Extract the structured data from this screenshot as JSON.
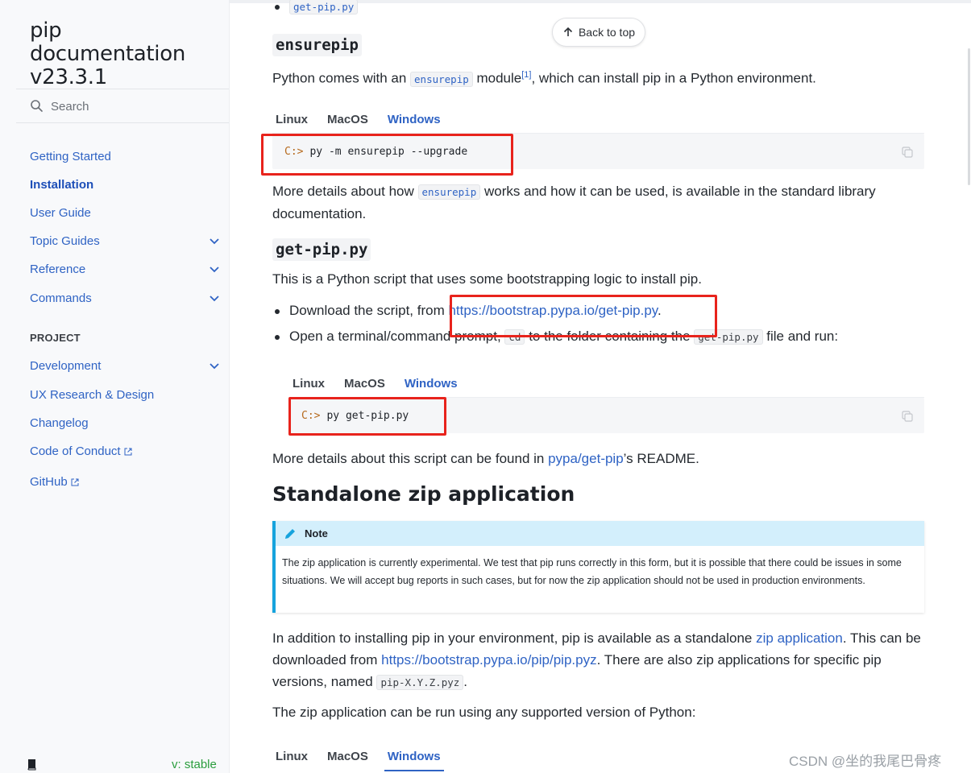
{
  "sidebar": {
    "brand": "pip documentation v23.3.1",
    "search_label": "Search",
    "items": [
      {
        "label": "Getting Started",
        "active": false,
        "expandable": false
      },
      {
        "label": "Installation",
        "active": true,
        "expandable": false
      },
      {
        "label": "User Guide",
        "active": false,
        "expandable": false
      },
      {
        "label": "Topic Guides",
        "active": false,
        "expandable": true
      },
      {
        "label": "Reference",
        "active": false,
        "expandable": true
      },
      {
        "label": "Commands",
        "active": false,
        "expandable": true
      }
    ],
    "project_caption": "PROJECT",
    "project_items": [
      {
        "label": "Development",
        "expandable": true,
        "external": false
      },
      {
        "label": "UX Research & Design",
        "expandable": false,
        "external": false
      },
      {
        "label": "Changelog",
        "expandable": false,
        "external": false
      },
      {
        "label": "Code of Conduct",
        "expandable": false,
        "external": true
      },
      {
        "label": "GitHub",
        "expandable": false,
        "external": true
      }
    ],
    "version_label": "v: stable"
  },
  "header": {
    "back_to_top": "Back to top"
  },
  "main": {
    "top_bullet_code": "get-pip.py",
    "ensurepip_section": {
      "heading": "ensurepip",
      "intro_before": "Python comes with an ",
      "intro_code": "ensurepip",
      "intro_mid": " module",
      "intro_ref": "[1]",
      "intro_after": ", which can install pip in a Python environment.",
      "tabs": [
        "Linux",
        "MacOS",
        "Windows"
      ],
      "active_tab": "Windows",
      "code_prompt": "C:>",
      "code_command": "py -m ensurepip --upgrade",
      "details_before": "More details about how ",
      "details_code": "ensurepip",
      "details_after_line1": " works and how it can be used, is available in the standard library",
      "details_line2": "documentation."
    },
    "getpip_section": {
      "heading": "get-pip.py",
      "intro": "This is a Python script that uses some bootstrapping logic to install pip.",
      "bullet1_before": "Download the script, from ",
      "bullet1_link": "https://bootstrap.pypa.io/get-pip.py",
      "bullet1_after": ".",
      "bullet2_before": "Open a terminal/command prompt, ",
      "bullet2_code1": "cd",
      "bullet2_mid": " to the folder containing the ",
      "bullet2_code2": "get-pip.py",
      "bullet2_after": " file and run:",
      "tabs": [
        "Linux",
        "MacOS",
        "Windows"
      ],
      "active_tab": "Windows",
      "code_prompt": "C:>",
      "code_command": "py get-pip.py",
      "readme_before": "More details about this script can be found in ",
      "readme_link": "pypa/get-pip",
      "readme_after": "’s README."
    },
    "standalone_section": {
      "heading": "Standalone zip application",
      "note_title": "Note",
      "note_text": "The zip application is currently experimental. We test that pip runs correctly in this form, but it is possible that there could be issues in some situations. We will accept bug reports in such cases, but for now the zip application should not be used in production environments.",
      "para1_before": "In addition to installing pip in your environment, pip is available as a standalone ",
      "para1_link1": "zip application",
      "para1_mid": ". This can be downloaded from ",
      "para1_link2": "https://bootstrap.pypa.io/pip/pip.pyz",
      "para1_after": ". There are also zip applications for specific pip versions, named ",
      "para1_code": "pip-X.Y.Z.pyz",
      "para1_end": ".",
      "para2": "The zip application can be run using any supported version of Python:",
      "tabs": [
        "Linux",
        "MacOS",
        "Windows"
      ],
      "active_tab": "Windows"
    }
  },
  "watermark": "CSDN @坐的我尾巴骨疼",
  "colors": {
    "link": "#2f63c4",
    "annotation_red": "#e8231c",
    "note_accent": "#16a3dd",
    "version_green": "#2a9d3d"
  }
}
